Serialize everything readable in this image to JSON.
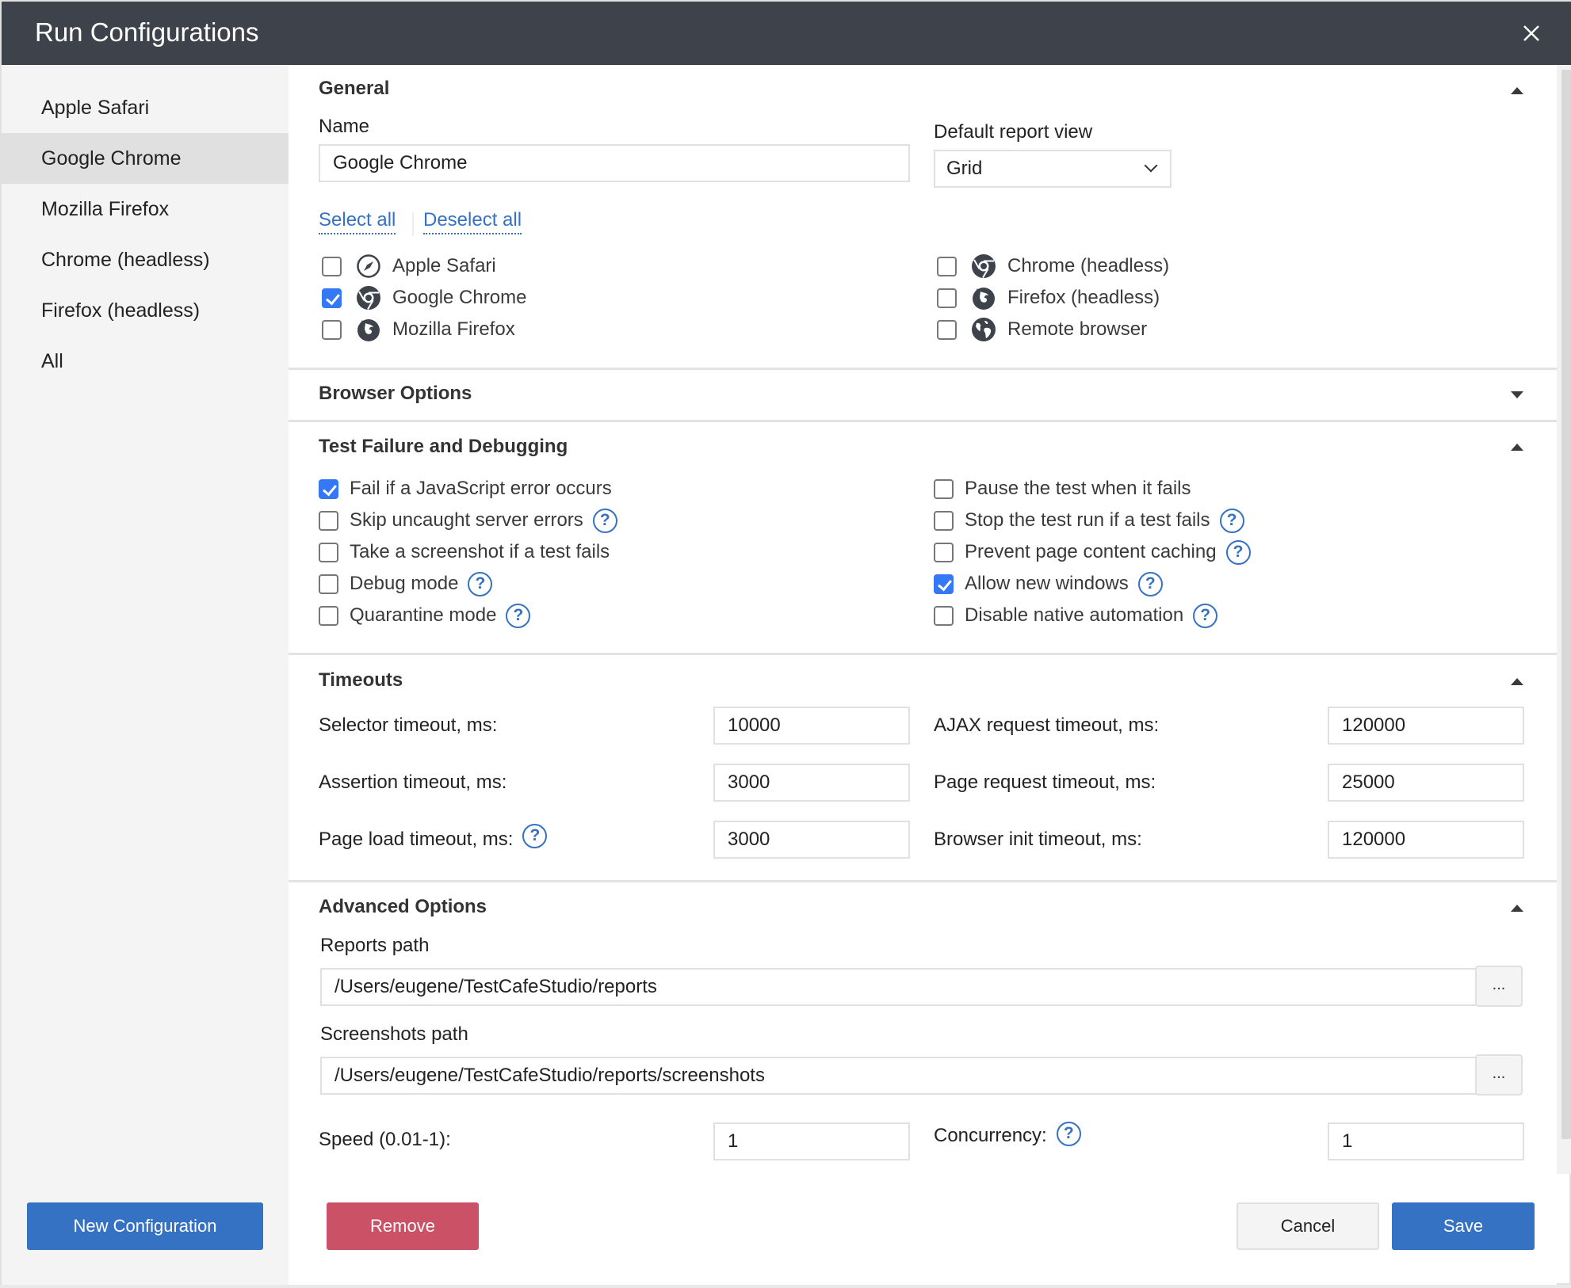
{
  "window": {
    "title": "Run Configurations",
    "close_icon": "close-icon"
  },
  "sidebar": {
    "items": [
      {
        "label": "Apple Safari",
        "active": false
      },
      {
        "label": "Google Chrome",
        "active": true
      },
      {
        "label": "Mozilla Firefox",
        "active": false
      },
      {
        "label": "Chrome (headless)",
        "active": false
      },
      {
        "label": "Firefox (headless)",
        "active": false
      },
      {
        "label": "All",
        "active": false
      }
    ],
    "new_button": "New Configuration"
  },
  "general": {
    "title": "General",
    "toggle": "collapse",
    "name_label": "Name",
    "name_value": "Google Chrome",
    "report_view_label": "Default report view",
    "report_view_value": "Grid",
    "select_all": "Select all",
    "deselect_all": "Deselect all",
    "browsers": [
      {
        "label": "Apple Safari",
        "icon": "safari-icon",
        "checked": false
      },
      {
        "label": "Google Chrome",
        "icon": "chrome-icon",
        "checked": true
      },
      {
        "label": "Mozilla Firefox",
        "icon": "firefox-icon",
        "checked": false
      },
      {
        "label": "Chrome (headless)",
        "icon": "chrome-icon",
        "checked": false
      },
      {
        "label": "Firefox (headless)",
        "icon": "firefox-icon",
        "checked": false
      },
      {
        "label": "Remote browser",
        "icon": "globe-icon",
        "checked": false
      }
    ]
  },
  "browser_options": {
    "title": "Browser Options",
    "toggle": "expand"
  },
  "debugging": {
    "title": "Test Failure and Debugging",
    "toggle": "collapse",
    "left": [
      {
        "label": "Fail if a JavaScript error occurs",
        "checked": true,
        "help": false
      },
      {
        "label": "Skip uncaught server errors",
        "checked": false,
        "help": true
      },
      {
        "label": "Take a screenshot if a test fails",
        "checked": false,
        "help": false
      },
      {
        "label": "Debug mode",
        "checked": false,
        "help": true
      },
      {
        "label": "Quarantine mode",
        "checked": false,
        "help": true
      }
    ],
    "right": [
      {
        "label": "Pause the test when it fails",
        "checked": false,
        "help": false
      },
      {
        "label": "Stop the test run if a test fails",
        "checked": false,
        "help": true
      },
      {
        "label": "Prevent page content caching",
        "checked": false,
        "help": true
      },
      {
        "label": "Allow new windows",
        "checked": true,
        "help": true
      },
      {
        "label": "Disable native automation",
        "checked": false,
        "help": true
      }
    ]
  },
  "timeouts": {
    "title": "Timeouts",
    "toggle": "collapse",
    "fields": [
      {
        "label": "Selector timeout, ms:",
        "value": "10000",
        "help": false
      },
      {
        "label": "AJAX request timeout, ms:",
        "value": "120000",
        "help": false
      },
      {
        "label": "Assertion timeout, ms:",
        "value": "3000",
        "help": false
      },
      {
        "label": "Page request timeout, ms:",
        "value": "25000",
        "help": false
      },
      {
        "label": "Page load timeout, ms:",
        "value": "3000",
        "help": true
      },
      {
        "label": "Browser init timeout, ms:",
        "value": "120000",
        "help": false
      }
    ]
  },
  "advanced": {
    "title": "Advanced Options",
    "toggle": "collapse",
    "reports_path_label": "Reports path",
    "reports_path_value": "/Users/eugene/TestCafeStudio/reports",
    "screenshots_path_label": "Screenshots path",
    "screenshots_path_value": "/Users/eugene/TestCafeStudio/reports/screenshots",
    "browse_label": "...",
    "speed_label": "Speed (0.01-1):",
    "speed_value": "1",
    "concurrency_label": "Concurrency:",
    "concurrency_value": "1",
    "help_glyph": "?"
  },
  "footer": {
    "remove": "Remove",
    "cancel": "Cancel",
    "save": "Save"
  },
  "colors": {
    "titlebar": "#3e434b",
    "primary": "#3672c4",
    "danger": "#ca5166",
    "checkbox_checked": "#3478f6",
    "sidebar_bg": "#f4f4f4",
    "sidebar_active": "#e0e0e0"
  }
}
